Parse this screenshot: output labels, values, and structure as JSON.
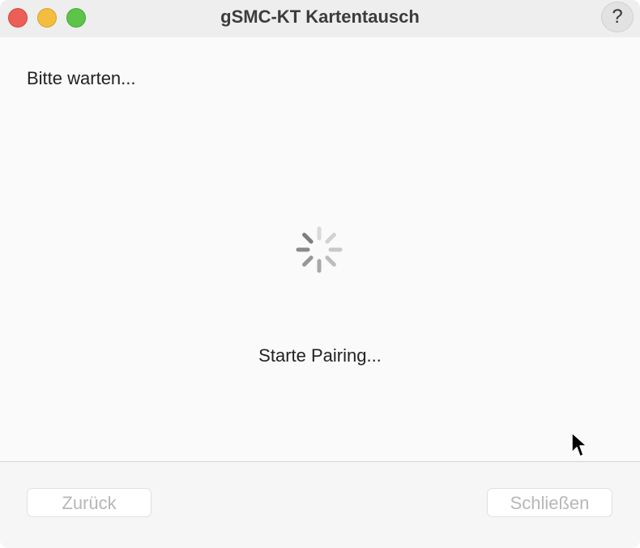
{
  "window": {
    "title": "gSMC-KT Kartentausch",
    "help_label": "?"
  },
  "content": {
    "heading": "Bitte warten...",
    "status": "Starte Pairing..."
  },
  "footer": {
    "back_label": "Zurück",
    "close_label": "Schließen"
  },
  "colors": {
    "traffic_close": "#ec5f57",
    "traffic_minimize": "#f4bd3f",
    "traffic_maximize": "#5bc449",
    "disabled_text": "#b7b7b7"
  },
  "icons": {
    "spinner": "activity-spinner-icon",
    "cursor": "mouse-pointer-icon"
  }
}
